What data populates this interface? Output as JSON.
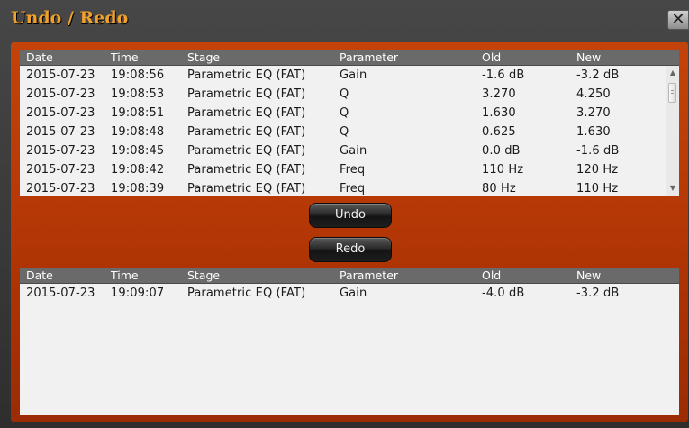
{
  "window": {
    "title": "Undo / Redo",
    "close_glyph": "✕"
  },
  "columns": [
    "Date",
    "Time",
    "Stage",
    "Parameter",
    "Old",
    "New"
  ],
  "undo_history": [
    {
      "date": "2015-07-23",
      "time": "19:08:56",
      "stage": "Parametric EQ (FAT)",
      "parameter": "Gain",
      "old": "-1.6 dB",
      "new": "-3.2 dB"
    },
    {
      "date": "2015-07-23",
      "time": "19:08:53",
      "stage": "Parametric EQ (FAT)",
      "parameter": "Q",
      "old": "3.270",
      "new": "4.250"
    },
    {
      "date": "2015-07-23",
      "time": "19:08:51",
      "stage": "Parametric EQ (FAT)",
      "parameter": "Q",
      "old": "1.630",
      "new": "3.270"
    },
    {
      "date": "2015-07-23",
      "time": "19:08:48",
      "stage": "Parametric EQ (FAT)",
      "parameter": "Q",
      "old": "0.625",
      "new": "1.630"
    },
    {
      "date": "2015-07-23",
      "time": "19:08:45",
      "stage": "Parametric EQ (FAT)",
      "parameter": "Gain",
      "old": "0.0 dB",
      "new": "-1.6 dB"
    },
    {
      "date": "2015-07-23",
      "time": "19:08:42",
      "stage": "Parametric EQ (FAT)",
      "parameter": "Freq",
      "old": "110 Hz",
      "new": "120 Hz"
    },
    {
      "date": "2015-07-23",
      "time": "19:08:39",
      "stage": "Parametric EQ (FAT)",
      "parameter": "Freq",
      "old": "80 Hz",
      "new": "110 Hz"
    }
  ],
  "redo_history": [
    {
      "date": "2015-07-23",
      "time": "19:09:07",
      "stage": "Parametric EQ (FAT)",
      "parameter": "Gain",
      "old": "-4.0 dB",
      "new": "-3.2 dB"
    }
  ],
  "buttons": {
    "undo_label": "Undo",
    "redo_label": "Redo"
  },
  "scrollbar": {
    "up_icon": "scroll-up-arrow-icon",
    "down_icon": "scroll-down-arrow-icon",
    "up_glyph": "▲",
    "down_glyph": "▼"
  },
  "colors": {
    "title": "#f0a12a",
    "panel": "#b53806",
    "header": "#6a6a6a",
    "table_bg": "#f1f1f1"
  }
}
